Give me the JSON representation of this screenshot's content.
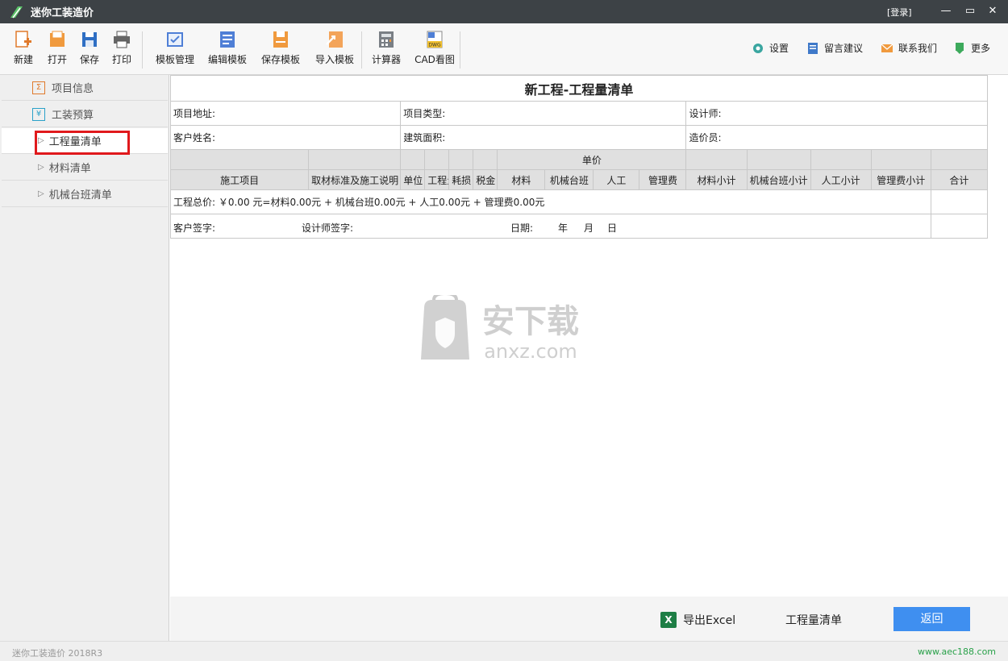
{
  "window": {
    "title": "迷你工装造价",
    "login_label": "[登录]"
  },
  "toolbar": {
    "new_label": "新建",
    "open_label": "打开",
    "save_label": "保存",
    "print_label": "打印",
    "template_manage_label": "模板管理",
    "template_edit_label": "编辑模板",
    "template_save_label": "保存模板",
    "template_import_label": "导入模板",
    "calculator_label": "计算器",
    "cad_label": "CAD看图",
    "settings_label": "设置",
    "feedback_label": "留言建议",
    "contact_label": "联系我们",
    "more_label": "更多"
  },
  "sidebar": {
    "items": [
      {
        "label": "项目信息",
        "icon": "Σ"
      },
      {
        "label": "工装预算",
        "icon": "¥"
      },
      {
        "label": "工程量清单"
      },
      {
        "label": "材料清单"
      },
      {
        "label": "机械台班清单"
      }
    ]
  },
  "sheet": {
    "title": "新工程-工程量清单",
    "address_label": "项目地址:",
    "type_label": "项目类型:",
    "designer_label": "设计师:",
    "client_label": "客户姓名:",
    "area_label": "建筑面积:",
    "cost_engineer_label": "造价员:",
    "unit_price_label": "单价",
    "columns": [
      "施工项目",
      "取材标准及施工说明",
      "单位",
      "工程量",
      "耗损",
      "税金",
      "材料",
      "机械台班",
      "人工",
      "管理费",
      "材料小计",
      "机械台班小计",
      "人工小计",
      "管理费小计",
      "合计"
    ],
    "total_text": "工程总价: ￥0.00 元=材料0.00元 + 机械台班0.00元 + 人工0.00元 + 管理费0.00元",
    "client_sign_label": "客户签字:",
    "designer_sign_label": "设计师签字:",
    "date_label": "日期:",
    "year_label": "年",
    "month_label": "月",
    "day_label": "日"
  },
  "watermark": {
    "text_cn": "安下载",
    "text_en": "anxz.com"
  },
  "footer": {
    "export_label": "导出Excel",
    "list_label": "工程量清单",
    "back_label": "返回"
  },
  "status": {
    "version": "迷你工装造价 2018R3",
    "site": "www.aec188.com"
  },
  "colors": {
    "titlebar": "#3d4246",
    "accent": "#3f8ff0",
    "highlight": "#e0191c",
    "excel": "#1e7e45"
  }
}
